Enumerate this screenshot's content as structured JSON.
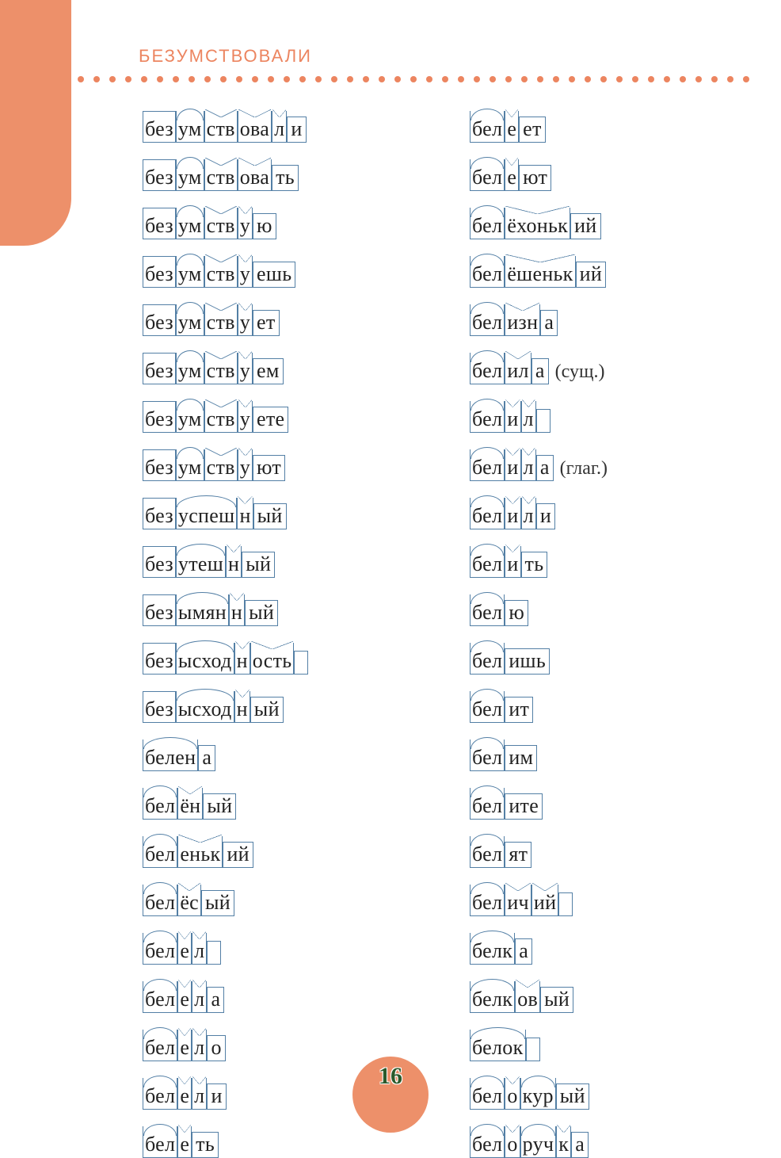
{
  "header": "БЕЗУМСТВОВАЛИ",
  "page": "16",
  "columns": [
    [
      {
        "segs": [
          {
            "t": "без",
            "m": "prefix"
          },
          {
            "t": "ум",
            "m": "root"
          },
          {
            "t": "ств",
            "m": "suffix"
          },
          {
            "t": "ова",
            "m": "suffix"
          },
          {
            "t": "л",
            "m": "suffix"
          },
          {
            "t": "и",
            "m": "ending"
          }
        ]
      },
      {
        "segs": [
          {
            "t": "без",
            "m": "prefix"
          },
          {
            "t": "ум",
            "m": "root"
          },
          {
            "t": "ств",
            "m": "suffix"
          },
          {
            "t": "ова",
            "m": "suffix"
          },
          {
            "t": "ть",
            "m": "ending"
          }
        ]
      },
      {
        "segs": [
          {
            "t": "без",
            "m": "prefix"
          },
          {
            "t": "ум",
            "m": "root"
          },
          {
            "t": "ств",
            "m": "suffix"
          },
          {
            "t": "у",
            "m": "suffix"
          },
          {
            "t": "ю",
            "m": "ending"
          }
        ]
      },
      {
        "segs": [
          {
            "t": "без",
            "m": "prefix"
          },
          {
            "t": "ум",
            "m": "root"
          },
          {
            "t": "ств",
            "m": "suffix"
          },
          {
            "t": "у",
            "m": "suffix"
          },
          {
            "t": "ешь",
            "m": "ending"
          }
        ]
      },
      {
        "segs": [
          {
            "t": "без",
            "m": "prefix"
          },
          {
            "t": "ум",
            "m": "root"
          },
          {
            "t": "ств",
            "m": "suffix"
          },
          {
            "t": "у",
            "m": "suffix"
          },
          {
            "t": "ет",
            "m": "ending"
          }
        ]
      },
      {
        "segs": [
          {
            "t": "без",
            "m": "prefix"
          },
          {
            "t": "ум",
            "m": "root"
          },
          {
            "t": "ств",
            "m": "suffix"
          },
          {
            "t": "у",
            "m": "suffix"
          },
          {
            "t": "ем",
            "m": "ending"
          }
        ]
      },
      {
        "segs": [
          {
            "t": "без",
            "m": "prefix"
          },
          {
            "t": "ум",
            "m": "root"
          },
          {
            "t": "ств",
            "m": "suffix"
          },
          {
            "t": "у",
            "m": "suffix"
          },
          {
            "t": "ете",
            "m": "ending"
          }
        ]
      },
      {
        "segs": [
          {
            "t": "без",
            "m": "prefix"
          },
          {
            "t": "ум",
            "m": "root"
          },
          {
            "t": "ств",
            "m": "suffix"
          },
          {
            "t": "у",
            "m": "suffix"
          },
          {
            "t": "ют",
            "m": "ending"
          }
        ]
      },
      {
        "segs": [
          {
            "t": "без",
            "m": "prefix"
          },
          {
            "t": "успеш",
            "m": "root"
          },
          {
            "t": "н",
            "m": "suffix"
          },
          {
            "t": "ый",
            "m": "ending"
          }
        ]
      },
      {
        "segs": [
          {
            "t": "без",
            "m": "prefix"
          },
          {
            "t": "утеш",
            "m": "root"
          },
          {
            "t": "н",
            "m": "suffix"
          },
          {
            "t": "ый",
            "m": "ending"
          }
        ]
      },
      {
        "segs": [
          {
            "t": "без",
            "m": "prefix"
          },
          {
            "t": "ымян",
            "m": "root"
          },
          {
            "t": "н",
            "m": "suffix"
          },
          {
            "t": "ый",
            "m": "ending"
          }
        ]
      },
      {
        "segs": [
          {
            "t": "без",
            "m": "prefix"
          },
          {
            "t": "ысход",
            "m": "root"
          },
          {
            "t": "н",
            "m": "suffix"
          },
          {
            "t": "ость",
            "m": "suffix"
          },
          {
            "t": "",
            "m": "ending"
          }
        ]
      },
      {
        "segs": [
          {
            "t": "без",
            "m": "prefix"
          },
          {
            "t": "ысход",
            "m": "root"
          },
          {
            "t": "н",
            "m": "suffix"
          },
          {
            "t": "ый",
            "m": "ending"
          }
        ]
      },
      {
        "segs": [
          {
            "t": "белен",
            "m": "root"
          },
          {
            "t": "а",
            "m": "ending"
          }
        ]
      },
      {
        "segs": [
          {
            "t": "бел",
            "m": "root"
          },
          {
            "t": "ён",
            "m": "suffix"
          },
          {
            "t": "ый",
            "m": "ending"
          }
        ]
      },
      {
        "segs": [
          {
            "t": "бел",
            "m": "root"
          },
          {
            "t": "еньк",
            "m": "suffix"
          },
          {
            "t": "ий",
            "m": "ending"
          }
        ]
      },
      {
        "segs": [
          {
            "t": "бел",
            "m": "root"
          },
          {
            "t": "ёс",
            "m": "suffix"
          },
          {
            "t": "ый",
            "m": "ending"
          }
        ]
      },
      {
        "segs": [
          {
            "t": "бел",
            "m": "root"
          },
          {
            "t": "е",
            "m": "suffix"
          },
          {
            "t": "л",
            "m": "suffix"
          },
          {
            "t": "",
            "m": "ending"
          }
        ]
      },
      {
        "segs": [
          {
            "t": "бел",
            "m": "root"
          },
          {
            "t": "е",
            "m": "suffix"
          },
          {
            "t": "л",
            "m": "suffix"
          },
          {
            "t": "а",
            "m": "ending"
          }
        ]
      },
      {
        "segs": [
          {
            "t": "бел",
            "m": "root"
          },
          {
            "t": "е",
            "m": "suffix"
          },
          {
            "t": "л",
            "m": "suffix"
          },
          {
            "t": "о",
            "m": "ending"
          }
        ]
      },
      {
        "segs": [
          {
            "t": "бел",
            "m": "root"
          },
          {
            "t": "е",
            "m": "suffix"
          },
          {
            "t": "л",
            "m": "suffix"
          },
          {
            "t": "и",
            "m": "ending"
          }
        ]
      },
      {
        "segs": [
          {
            "t": "бел",
            "m": "root"
          },
          {
            "t": "е",
            "m": "suffix"
          },
          {
            "t": "ть",
            "m": "ending"
          }
        ]
      }
    ],
    [
      {
        "segs": [
          {
            "t": "бел",
            "m": "root"
          },
          {
            "t": "е",
            "m": "suffix"
          },
          {
            "t": "ет",
            "m": "ending"
          }
        ]
      },
      {
        "segs": [
          {
            "t": "бел",
            "m": "root"
          },
          {
            "t": "е",
            "m": "suffix"
          },
          {
            "t": "ют",
            "m": "ending"
          }
        ]
      },
      {
        "segs": [
          {
            "t": "бел",
            "m": "root"
          },
          {
            "t": "ёхоньк",
            "m": "suffix"
          },
          {
            "t": "ий",
            "m": "ending"
          }
        ]
      },
      {
        "segs": [
          {
            "t": "бел",
            "m": "root"
          },
          {
            "t": "ёшеньк",
            "m": "suffix"
          },
          {
            "t": "ий",
            "m": "ending"
          }
        ]
      },
      {
        "segs": [
          {
            "t": "бел",
            "m": "root"
          },
          {
            "t": "изн",
            "m": "suffix"
          },
          {
            "t": "а",
            "m": "ending"
          }
        ]
      },
      {
        "segs": [
          {
            "t": "бел",
            "m": "root"
          },
          {
            "t": "ил",
            "m": "suffix"
          },
          {
            "t": "а",
            "m": "ending"
          }
        ],
        "annot": "(сущ.)"
      },
      {
        "segs": [
          {
            "t": "бел",
            "m": "root"
          },
          {
            "t": "и",
            "m": "suffix"
          },
          {
            "t": "л",
            "m": "suffix"
          },
          {
            "t": "",
            "m": "ending"
          }
        ]
      },
      {
        "segs": [
          {
            "t": "бел",
            "m": "root"
          },
          {
            "t": "и",
            "m": "suffix"
          },
          {
            "t": "л",
            "m": "suffix"
          },
          {
            "t": "а",
            "m": "ending"
          }
        ],
        "annot": "(глаг.)"
      },
      {
        "segs": [
          {
            "t": "бел",
            "m": "root"
          },
          {
            "t": "и",
            "m": "suffix"
          },
          {
            "t": "л",
            "m": "suffix"
          },
          {
            "t": "и",
            "m": "ending"
          }
        ]
      },
      {
        "segs": [
          {
            "t": "бел",
            "m": "root"
          },
          {
            "t": "и",
            "m": "suffix"
          },
          {
            "t": "ть",
            "m": "ending"
          }
        ]
      },
      {
        "segs": [
          {
            "t": "бел",
            "m": "root"
          },
          {
            "t": "ю",
            "m": "ending"
          }
        ]
      },
      {
        "segs": [
          {
            "t": "бел",
            "m": "root"
          },
          {
            "t": "ишь",
            "m": "ending"
          }
        ]
      },
      {
        "segs": [
          {
            "t": "бел",
            "m": "root"
          },
          {
            "t": "ит",
            "m": "ending"
          }
        ]
      },
      {
        "segs": [
          {
            "t": "бел",
            "m": "root"
          },
          {
            "t": "им",
            "m": "ending"
          }
        ]
      },
      {
        "segs": [
          {
            "t": "бел",
            "m": "root"
          },
          {
            "t": "ите",
            "m": "ending"
          }
        ]
      },
      {
        "segs": [
          {
            "t": "бел",
            "m": "root"
          },
          {
            "t": "ят",
            "m": "ending"
          }
        ]
      },
      {
        "segs": [
          {
            "t": "бел",
            "m": "root"
          },
          {
            "t": "ич",
            "m": "suffix"
          },
          {
            "t": "ий",
            "m": "suffix"
          },
          {
            "t": "",
            "m": "ending"
          }
        ]
      },
      {
        "segs": [
          {
            "t": "белк",
            "m": "root"
          },
          {
            "t": "а",
            "m": "ending"
          }
        ]
      },
      {
        "segs": [
          {
            "t": "белк",
            "m": "root"
          },
          {
            "t": "ов",
            "m": "suffix"
          },
          {
            "t": "ый",
            "m": "ending"
          }
        ]
      },
      {
        "segs": [
          {
            "t": "белок",
            "m": "root"
          },
          {
            "t": "",
            "m": "ending"
          }
        ]
      },
      {
        "segs": [
          {
            "t": "бел",
            "m": "root"
          },
          {
            "t": "о",
            "m": "suffix"
          },
          {
            "t": "кур",
            "m": "root"
          },
          {
            "t": "ый",
            "m": "ending"
          }
        ]
      },
      {
        "segs": [
          {
            "t": "бел",
            "m": "root"
          },
          {
            "t": "о",
            "m": "suffix"
          },
          {
            "t": "руч",
            "m": "root"
          },
          {
            "t": "к",
            "m": "suffix"
          },
          {
            "t": "а",
            "m": "ending"
          }
        ]
      }
    ]
  ]
}
